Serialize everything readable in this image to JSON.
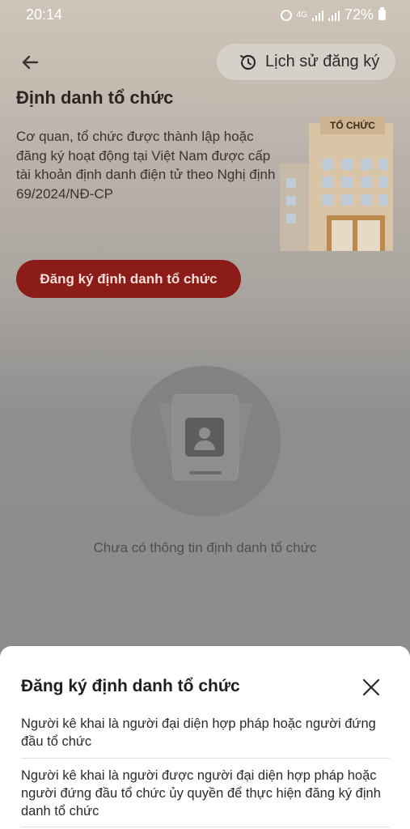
{
  "status_bar": {
    "time": "20:14",
    "network": "4G",
    "battery": "72%"
  },
  "header": {
    "history_label": "Lịch sử đăng ký",
    "title": "Định danh tổ chức",
    "description": "Cơ quan, tổ chức được thành lập hoặc đăng ký hoạt động tại Việt Nam được cấp tài khoản định danh điện tử theo Nghị định 69/2024/NĐ-CP",
    "building_sign": "TỔ CHỨC"
  },
  "register_button": "Đăng ký định danh tổ chức",
  "empty_state": {
    "text": "Chưa có thông tin định danh tổ chức"
  },
  "sheet": {
    "title": "Đăng ký định danh tổ chức",
    "options": [
      "Người kê khai là người đại diện hợp pháp hoặc người đứng đầu tổ chức",
      "Người kê khai là người được người đại diện hợp pháp hoặc người đứng đầu tổ chức ủy quyền để thực hiện đăng ký định danh tổ chức"
    ]
  },
  "colors": {
    "primary": "#c6251f",
    "sheet_bg": "#ffffff"
  }
}
